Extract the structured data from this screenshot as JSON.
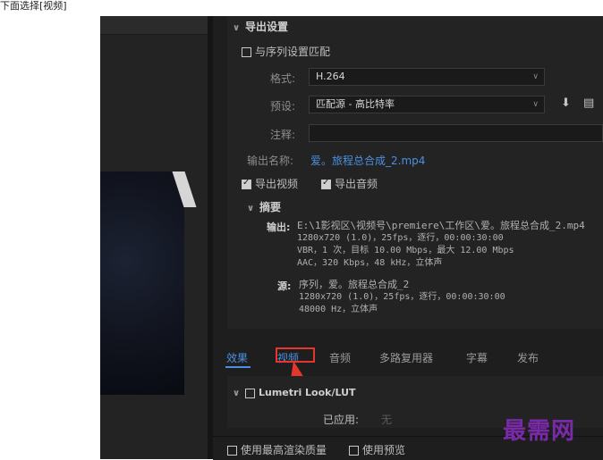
{
  "caption": "下面选择[视频]",
  "export_settings": {
    "section_title": "导出设置",
    "match_sequence_label": "与序列设置匹配",
    "format_label": "格式:",
    "format_value": "H.264",
    "preset_label": "预设:",
    "preset_value": "匹配源 - 高比特率",
    "comment_label": "注释:",
    "output_name_label": "输出名称:",
    "output_name_value": "爱。旅程总合成_2.mp4",
    "export_video_label": "导出视频",
    "export_audio_label": "导出音频"
  },
  "summary": {
    "title": "摘要",
    "output_label": "输出:",
    "output_lines": [
      "E:\\1影视区\\视频号\\premiere\\工作区\\爱。旅程总合成_2.mp4",
      "1280x720 (1.0)，25fps，逐行，00:00:30:00",
      "VBR，1 次，目标 10.00 Mbps，最大 12.00 Mbps",
      "AAC，320 Kbps，48 kHz，立体声"
    ],
    "source_label": "源:",
    "source_lines": [
      "序列，爱。旅程总合成_2",
      "1280x720 (1.0)，25fps，逐行，00:00:30:00",
      "48000 Hz，立体声"
    ]
  },
  "tabs": [
    "效果",
    "视频",
    "音频",
    "多路复用器",
    "字幕",
    "发布"
  ],
  "effect": {
    "lumetri_label": "Lumetri Look/LUT",
    "applied_label": "已应用:",
    "applied_value": "无"
  },
  "bottom": {
    "max_render_label": "使用最高渲染质量",
    "use_preview_label": "使用预览"
  },
  "watermark": "最需网",
  "colors": {
    "accent": "#4c8fe0",
    "highlight": "#e5362e",
    "watermark": "#7a2aa8"
  }
}
